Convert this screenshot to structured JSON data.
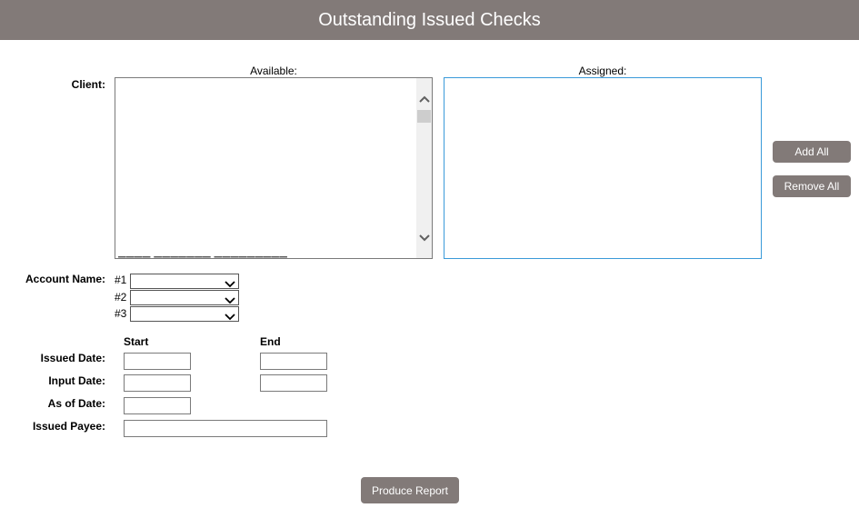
{
  "header": {
    "title": "Outstanding Issued Checks"
  },
  "client": {
    "label": "Client:",
    "available_label": "Available:",
    "assigned_label": "Assigned:",
    "available_items": [],
    "assigned_items": []
  },
  "buttons": {
    "add_all": "Add All",
    "remove_all": "Remove All",
    "produce_report": "Produce Report"
  },
  "account": {
    "label": "Account Name:",
    "selects": [
      {
        "prefix": "#1",
        "value": ""
      },
      {
        "prefix": "#2",
        "value": ""
      },
      {
        "prefix": "#3",
        "value": ""
      }
    ]
  },
  "dates": {
    "start_header": "Start",
    "end_header": "End",
    "issued_date_label": "Issued Date:",
    "issued_start": "",
    "issued_end": "",
    "input_date_label": "Input Date:",
    "input_start": "",
    "input_end": "",
    "as_of_label": "As of Date:",
    "as_of_value": ""
  },
  "payee": {
    "label": "Issued Payee:",
    "value": ""
  },
  "icons": {
    "scroll_up": "chevron-up-icon",
    "scroll_down": "chevron-down-icon",
    "dropdown": "chevron-down-icon"
  }
}
